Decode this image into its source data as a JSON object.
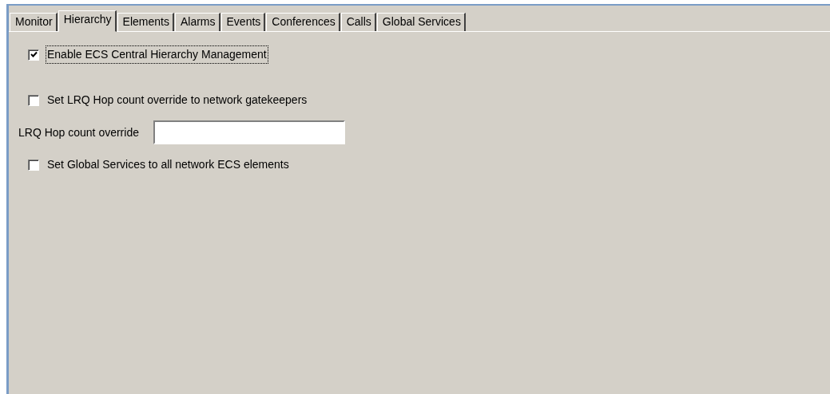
{
  "tabs": [
    {
      "label": "Monitor",
      "selected": false
    },
    {
      "label": "Hierarchy",
      "selected": true
    },
    {
      "label": "Elements",
      "selected": false
    },
    {
      "label": "Alarms",
      "selected": false
    },
    {
      "label": "Events",
      "selected": false
    },
    {
      "label": "Conferences",
      "selected": false
    },
    {
      "label": "Calls",
      "selected": false
    },
    {
      "label": "Global Services",
      "selected": false
    }
  ],
  "fields": [
    {
      "kind": "checkbox",
      "label": "Enable ECS Central Hierarchy Management",
      "checked": true,
      "focused": true
    },
    {
      "kind": "checkbox",
      "label": "Set LRQ Hop count override to network gatekeepers",
      "checked": false,
      "focused": false
    },
    {
      "kind": "text",
      "label": "LRQ Hop count override"
    },
    {
      "kind": "checkbox",
      "label": "Set Global Services to all network ECS elements",
      "checked": false,
      "focused": false
    }
  ]
}
